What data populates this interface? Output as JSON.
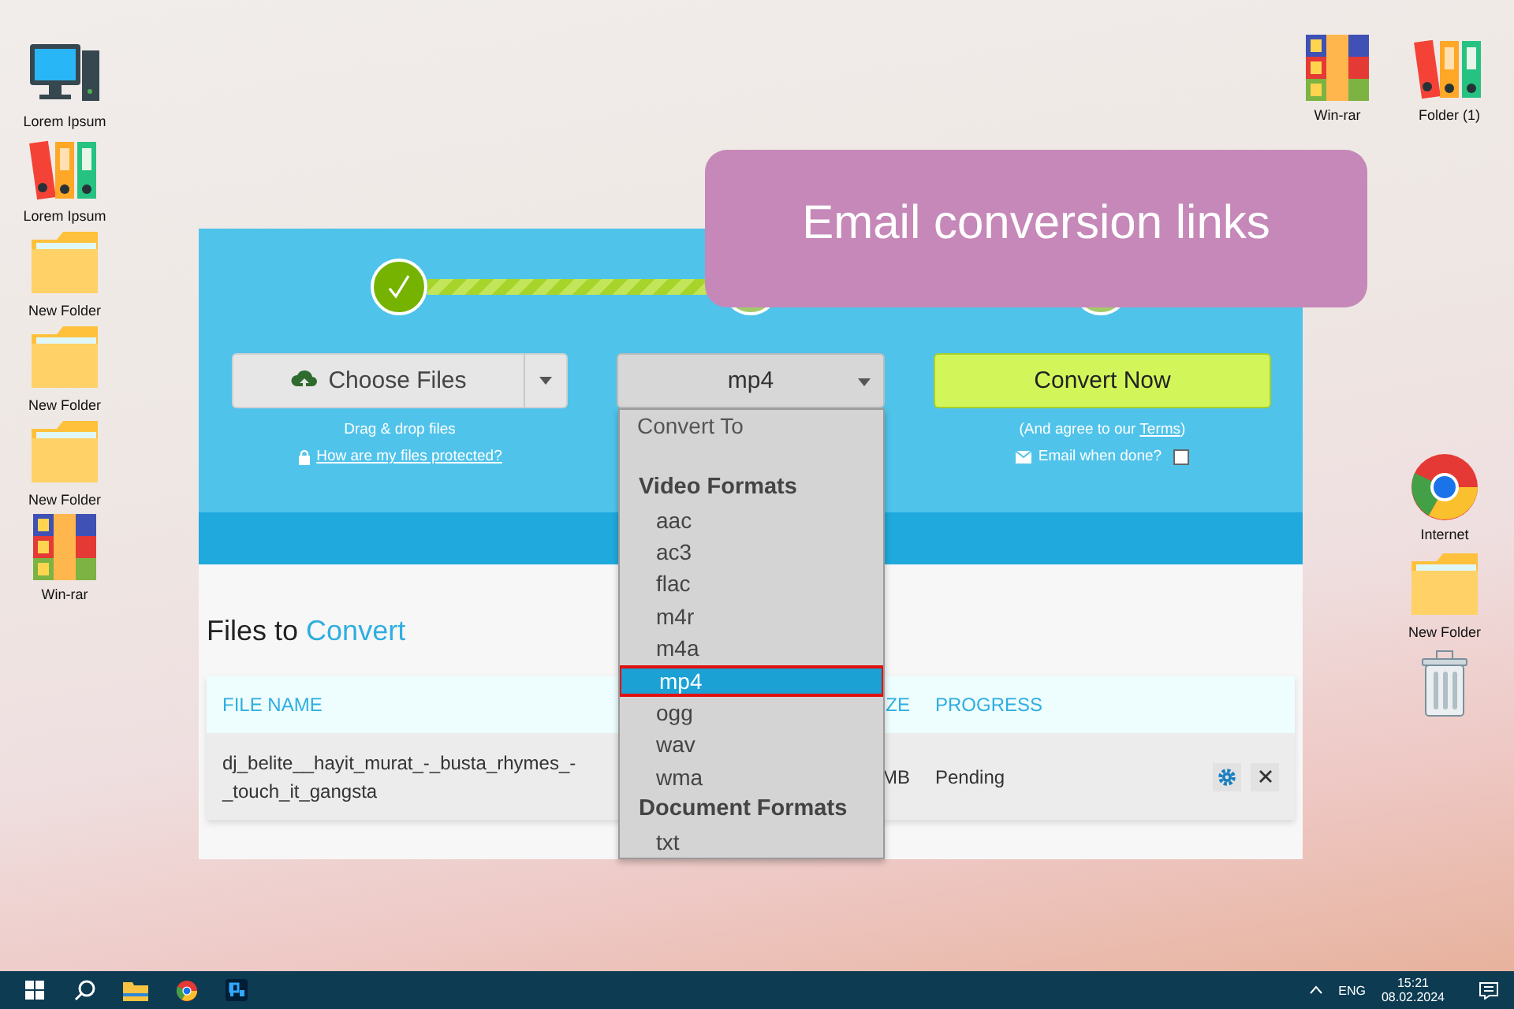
{
  "desktop_left": [
    {
      "kind": "computer",
      "label": "Lorem Ipsum"
    },
    {
      "kind": "binders",
      "label": "Lorem Ipsum"
    },
    {
      "kind": "folder",
      "label": "New Folder"
    },
    {
      "kind": "folder",
      "label": "New Folder"
    },
    {
      "kind": "folder",
      "label": "New Folder"
    },
    {
      "kind": "archive",
      "label": "Win-rar"
    }
  ],
  "desktop_top_right": [
    {
      "kind": "archive",
      "label": "Win-rar"
    },
    {
      "kind": "binders",
      "label": "Folder (1)"
    }
  ],
  "desktop_right": [
    {
      "kind": "browser",
      "label": "Internet"
    },
    {
      "kind": "folder",
      "label": "New Folder"
    },
    {
      "kind": "trash"
    }
  ],
  "converter": {
    "steps": [
      {
        "done": true
      },
      {
        "done": false
      },
      {
        "done": false
      }
    ],
    "choose_files": "Choose Files",
    "drag_hint": "Drag & drop files",
    "protect_link": "How are my files protected?",
    "format_select": "mp4",
    "convert_button": "Convert Now",
    "terms_prefix": "(And agree to our ",
    "terms_link": "Terms",
    "terms_suffix": ")",
    "email_label": "Email when done?",
    "email_checked": false,
    "dropdown": {
      "header": "Convert To",
      "groups": [
        {
          "label": "Video Formats",
          "options": [
            {
              "label": "aac",
              "selected": false
            },
            {
              "label": "ac3",
              "selected": false
            },
            {
              "label": "flac",
              "selected": false
            },
            {
              "label": "m4r",
              "selected": false
            },
            {
              "label": "m4a",
              "selected": false
            },
            {
              "label": "mp4",
              "selected": true
            },
            {
              "label": "ogg",
              "selected": false
            },
            {
              "label": "wav",
              "selected": false
            },
            {
              "label": "wma",
              "selected": false
            }
          ]
        },
        {
          "label": "Document Formats",
          "options": [
            {
              "label": "txt",
              "selected": false
            }
          ]
        }
      ]
    },
    "files_title": "Files to",
    "files_title_accent": "Convert",
    "table": {
      "columns": [
        "FILE NAME",
        "ZE",
        "PROGRESS"
      ],
      "rows": [
        {
          "cells": [
            "dj_belite__hayit_murat_-_busta_rhymes_-_touch_it_gangsta",
            "MB",
            "Pending"
          ]
        }
      ]
    }
  },
  "callout": "Email conversion links",
  "taskbar": {
    "language": "ENG",
    "time": "15:21",
    "date": "08.02.2024"
  }
}
